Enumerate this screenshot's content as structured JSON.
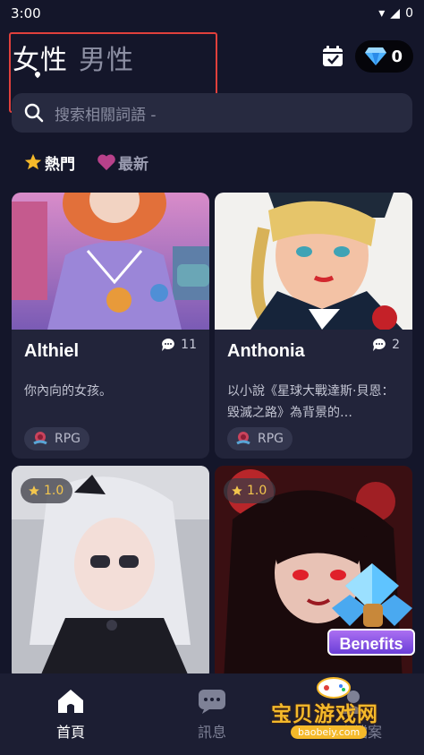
{
  "status_bar": {
    "time": "3:00",
    "signal": "signal-icon",
    "battery_text": "0"
  },
  "header": {
    "tabs": [
      {
        "label": "女性",
        "active": true
      },
      {
        "label": "男性",
        "active": false
      }
    ],
    "gem_count": "0"
  },
  "search": {
    "placeholder": "搜索相關詞語 -"
  },
  "filters": [
    {
      "label": "熱門",
      "icon": "star-icon",
      "active": true
    },
    {
      "label": "最新",
      "icon": "heart-icon",
      "active": false
    }
  ],
  "cards": [
    {
      "name": "Althiel",
      "comments": "11",
      "description": "你內向的女孩。",
      "tag": "RPG"
    },
    {
      "name": "Anthonia",
      "comments": "2",
      "description": "以小說《星球大戰達斯·貝恩：毀滅之路》為背景的…",
      "tag": "RPG"
    },
    {
      "rating": "1.0"
    },
    {
      "rating": "1.0"
    }
  ],
  "promo": {
    "label": "Benefits"
  },
  "bottom_nav": [
    {
      "label": "首頁",
      "icon": "home-icon",
      "active": true
    },
    {
      "label": "訊息",
      "icon": "chat-icon",
      "active": false
    },
    {
      "label": "個人檔案",
      "icon": "profile-icon",
      "active": false
    }
  ],
  "watermark": {
    "title": "宝贝游戏网",
    "url": "baobeiy.com"
  },
  "colors": {
    "background": "#14162a",
    "card": "#22243a",
    "accent_star": "#f3c64d",
    "annotation": "#e0403c"
  }
}
